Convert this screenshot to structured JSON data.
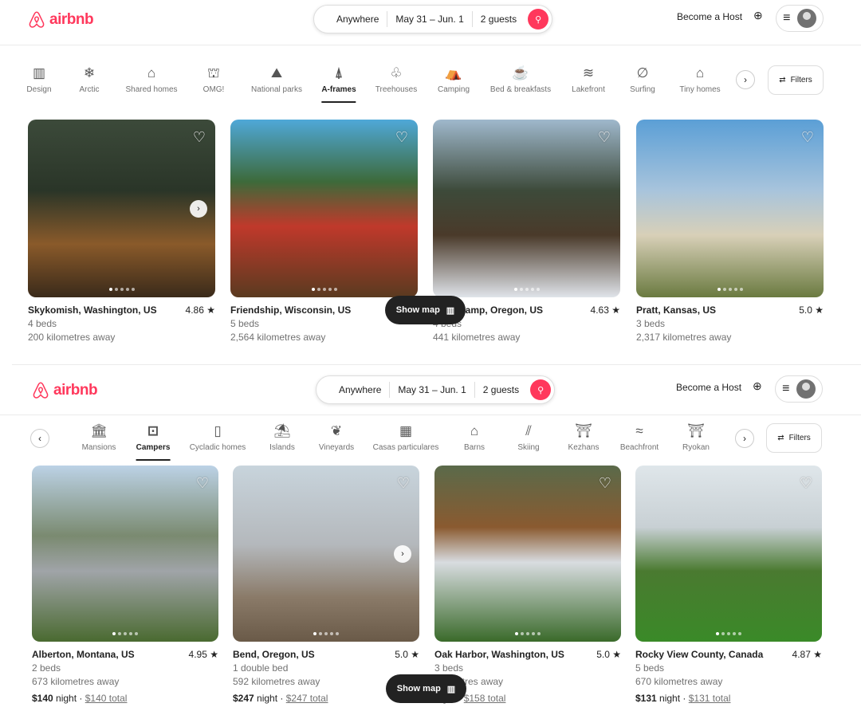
{
  "brand": {
    "name": "airbnb",
    "color": "#ff385c"
  },
  "screens": [
    {
      "search": {
        "where": "Anywhere",
        "when": "May 31 – Jun. 1",
        "who": "2 guests"
      },
      "host": "Become a Host",
      "filters": "Filters",
      "show_map": "Show map",
      "categories": [
        {
          "label": "Design",
          "icon": "design-icon",
          "glyph": "▥"
        },
        {
          "label": "Arctic",
          "icon": "snowflake-icon",
          "glyph": "❄"
        },
        {
          "label": "Shared homes",
          "icon": "shared-home-icon",
          "glyph": "⌂"
        },
        {
          "label": "OMG!",
          "icon": "ufo-icon",
          "glyph": "⛫"
        },
        {
          "label": "National parks",
          "icon": "national-park-icon",
          "glyph": "⛰"
        },
        {
          "label": "A-frames",
          "icon": "a-frame-icon",
          "glyph": "⍋",
          "active": true
        },
        {
          "label": "Treehouses",
          "icon": "treehouse-icon",
          "glyph": "♧"
        },
        {
          "label": "Camping",
          "icon": "tent-icon",
          "glyph": "⛺"
        },
        {
          "label": "Bed & breakfasts",
          "icon": "coffee-icon",
          "glyph": "☕"
        },
        {
          "label": "Lakefront",
          "icon": "lakefront-icon",
          "glyph": "≋"
        },
        {
          "label": "Surfing",
          "icon": "surfboard-icon",
          "glyph": "∅"
        },
        {
          "label": "Tiny homes",
          "icon": "tiny-home-icon",
          "glyph": "⌂"
        }
      ],
      "listings": [
        {
          "title": "Skykomish, Washington, US",
          "rating": "4.86",
          "line1": "4 beds",
          "line2": "200 kilometres away",
          "next": true
        },
        {
          "title": "Friendship, Wisconsin, US",
          "rating": "",
          "line1": "5 beds",
          "line2": "2,564 kilometres away"
        },
        {
          "title": "ment Camp, Oregon, US",
          "rating": "4.63",
          "line1": "4 beds",
          "line2": "441 kilometres away"
        },
        {
          "title": "Pratt, Kansas, US",
          "rating": "5.0",
          "line1": "3 beds",
          "line2": "2,317 kilometres away"
        }
      ]
    },
    {
      "search": {
        "where": "Anywhere",
        "when": "May 31 – Jun. 1",
        "who": "2 guests"
      },
      "host": "Become a Host",
      "filters": "Filters",
      "show_map": "Show map",
      "categories": [
        {
          "label": "Mansions",
          "icon": "mansion-icon",
          "glyph": "🏛"
        },
        {
          "label": "Campers",
          "icon": "camper-icon",
          "glyph": "⊡",
          "active": true
        },
        {
          "label": "Cycladic homes",
          "icon": "cycladic-home-icon",
          "glyph": "▯"
        },
        {
          "label": "Islands",
          "icon": "island-icon",
          "glyph": "⛱"
        },
        {
          "label": "Vineyards",
          "icon": "grapes-icon",
          "glyph": "❦"
        },
        {
          "label": "Casas particulares",
          "icon": "casa-icon",
          "glyph": "▦"
        },
        {
          "label": "Barns",
          "icon": "barn-icon",
          "glyph": "⌂"
        },
        {
          "label": "Skiing",
          "icon": "ski-icon",
          "glyph": "⫽"
        },
        {
          "label": "Kezhans",
          "icon": "kezhan-icon",
          "glyph": "⛩"
        },
        {
          "label": "Beachfront",
          "icon": "beach-icon",
          "glyph": "≈"
        },
        {
          "label": "Ryokan",
          "icon": "ryokan-icon",
          "glyph": "⛩"
        }
      ],
      "listings": [
        {
          "title": "Alberton, Montana, US",
          "rating": "4.95",
          "line1": "2 beds",
          "line2": "673 kilometres away",
          "night": "$140",
          "total": "$140 total"
        },
        {
          "title": "Bend, Oregon, US",
          "rating": "5.0",
          "line1": "1 double bed",
          "line2": "592 kilometres away",
          "night": "$247",
          "total": "$247 total",
          "next": true
        },
        {
          "title": "Oak Harbor, Washington, US",
          "rating": "5.0",
          "line1": "3 beds",
          "line2": "kilometres away",
          "night": "",
          "total": "$158 total"
        },
        {
          "title": "Rocky View County, Canada",
          "rating": "4.87",
          "line1": "5 beds",
          "line2": "670 kilometres away",
          "night": "$131",
          "total": "$131 total"
        }
      ]
    }
  ],
  "labels": {
    "night": "night",
    "dot": " · ",
    "star": "★"
  }
}
